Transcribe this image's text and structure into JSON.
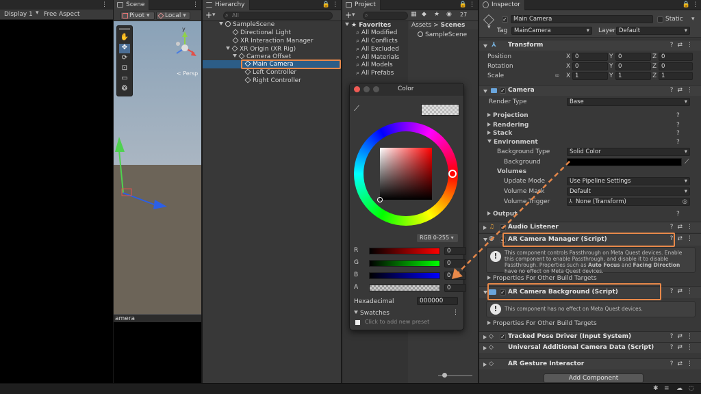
{
  "game_view": {
    "display": "Display 1",
    "aspect": "Free Aspect"
  },
  "scene": {
    "tab": "Scene",
    "pivot": "Pivot",
    "local": "Local",
    "persp": "< Persp",
    "bottom_label": "amera",
    "axis_y": "y"
  },
  "hierarchy": {
    "tab": "Hierarchy",
    "search_placeholder": "All",
    "items": [
      {
        "label": "SampleScene"
      },
      {
        "label": "Directional Light"
      },
      {
        "label": "XR Interaction Manager"
      },
      {
        "label": "XR Origin (XR Rig)"
      },
      {
        "label": "Camera Offset"
      },
      {
        "label": "Main Camera"
      },
      {
        "label": "Left Controller"
      },
      {
        "label": "Right Controller"
      }
    ]
  },
  "project": {
    "tab": "Project",
    "badge": "27",
    "favorites": "Favorites",
    "fav_items": [
      "All Modified",
      "All Conflicts",
      "All Excluded",
      "All Materials",
      "All Models",
      "All Prefabs"
    ],
    "breadcrumb_root": "Assets",
    "breadcrumb_sep": ">",
    "breadcrumb_leaf": "Scenes",
    "asset": "SampleScene"
  },
  "color_picker": {
    "title": "Color",
    "mode": "RGB 0-255",
    "channels": [
      {
        "label": "R",
        "value": "0"
      },
      {
        "label": "G",
        "value": "0"
      },
      {
        "label": "B",
        "value": "0"
      },
      {
        "label": "A",
        "value": "0"
      }
    ],
    "hex_label": "Hexadecimal",
    "hex_value": "000000",
    "swatches_label": "Swatches",
    "swatch_hint": "Click to add new preset"
  },
  "inspector": {
    "tab": "Inspector",
    "object_name": "Main Camera",
    "static_label": "Static",
    "tag_label": "Tag",
    "tag_value": "MainCamera",
    "layer_label": "Layer",
    "layer_value": "Default",
    "transform": {
      "title": "Transform",
      "rows": [
        {
          "label": "Position",
          "x": "0",
          "y": "0",
          "z": "0"
        },
        {
          "label": "Rotation",
          "x": "0",
          "y": "0",
          "z": "0"
        },
        {
          "label": "Scale",
          "x": "1",
          "y": "1",
          "z": "1"
        }
      ],
      "axes": [
        "X",
        "Y",
        "Z"
      ]
    },
    "camera": {
      "title": "Camera",
      "render_type_label": "Render Type",
      "render_type_value": "Base",
      "projection": "Projection",
      "rendering": "Rendering",
      "stack": "Stack",
      "environment": "Environment",
      "background_type_label": "Background Type",
      "background_type_value": "Solid Color",
      "background_label": "Background",
      "volumes": "Volumes",
      "update_mode_label": "Update Mode",
      "update_mode_value": "Use Pipeline Settings",
      "volume_mask_label": "Volume Mask",
      "volume_mask_value": "Default",
      "volume_trigger_label": "Volume Trigger",
      "volume_trigger_value": "None (Transform)",
      "output": "Output"
    },
    "audio_listener": "Audio Listener",
    "ar_camera_manager": {
      "title": "AR Camera Manager (Script)",
      "info_1": "This component controls Passthrough on Meta Quest devices. Enable this component to enable Passthrough, and disable it to disable Passthrough. Properties such as ",
      "info_b1": "Auto Focus",
      "info_2": " and ",
      "info_b2": "Facing Direction",
      "info_3": " have no effect on Meta Quest devices.",
      "other_targets": "Properties For Other Build Targets"
    },
    "ar_camera_background": {
      "title": "AR Camera Background (Script)",
      "info": "This component has no effect on Meta Quest devices.",
      "other_targets": "Properties For Other Build Targets"
    },
    "tracked_pose_driver": "Tracked Pose Driver (Input System)",
    "urp_camera_data": "Universal Additional Camera Data (Script)",
    "ar_gesture": "AR Gesture Interactor",
    "add_component": "Add Component"
  },
  "colors": {
    "accent": "#e8894a",
    "selection": "#2c5d87"
  }
}
